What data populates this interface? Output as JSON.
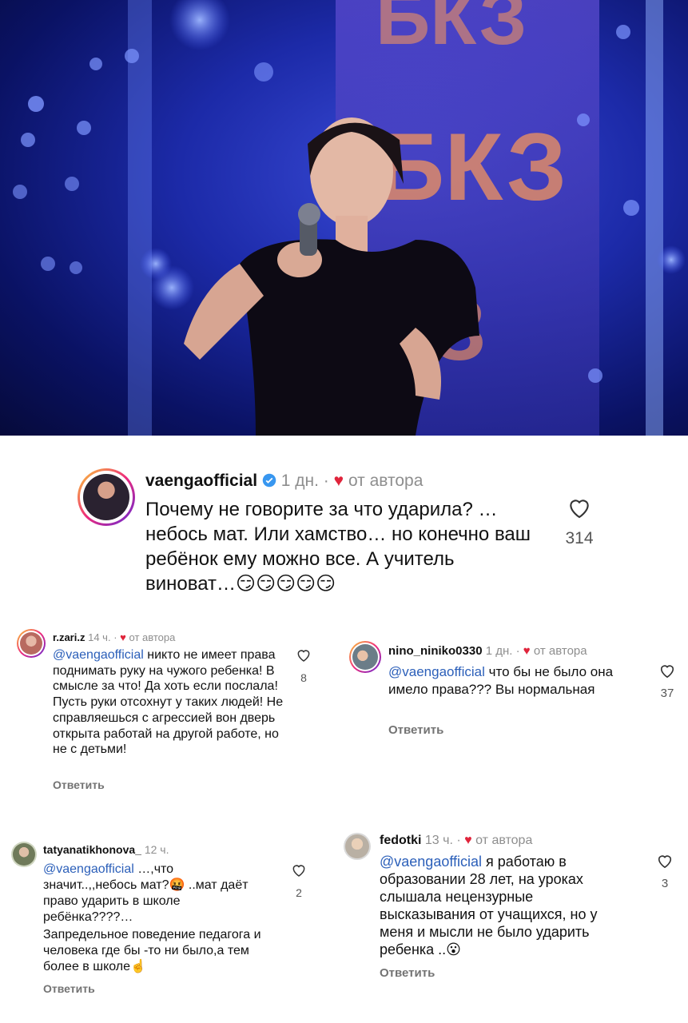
{
  "photo": {
    "description_icon": "concert-photo-singer-with-microphone",
    "stage_logo_text": "БКЗ"
  },
  "main_comment": {
    "username": "vaengaofficial",
    "time": "1 дн.",
    "dot": "·",
    "author_label": "от автора",
    "text": "Почему не говорите за что ударила? … небось мат. Или хамство… но конечно ваш ребёнок ему можно все. А учитель виноват…😏😏😏😏😏",
    "likes": "314"
  },
  "comments": [
    {
      "username": "r.zari.z",
      "time": "14 ч.",
      "dot": "·",
      "author_label": "от автора",
      "mention": "@vaengaofficial",
      "text": " никто не имеет права поднимать руку на чужого ребенка! В смысле за что! Да хоть если послала! Пусть руки отсохнут у таких людей! Не справляешься с агрессией вон дверь открыта работай на другой работе, но не с детьми!",
      "reply": "Ответить",
      "likes": "8"
    },
    {
      "username": "nino_niniko0330",
      "time": "1 дн.",
      "dot": "·",
      "author_label": "от автора",
      "mention": "@vaengaofficial",
      "text": " что бы не было она имело права??? Вы нормальная",
      "reply": "Ответить",
      "likes": "37"
    },
    {
      "username": "tatyanatikhonova_",
      "time": "12 ч.",
      "mention": "@vaengaofficial",
      "text": " …,что значит..,,небось мат?🤬 ..мат даёт право ударить в школе ребёнка????…",
      "text2": "Запредельное поведение педагога и человека где бы -то ни было,а тем более в школе☝️",
      "reply": "Ответить",
      "likes": "2"
    },
    {
      "username": "fedotki",
      "time": "13 ч.",
      "dot": "·",
      "author_label": "от автора",
      "mention": "@vaengaofficial",
      "text": " я работаю в образовании 28 лет, на уроках слышала нецензурные высказывания от учащихся, но у меня и мысли не было ударить ребенка ..😮",
      "reply": "Ответить",
      "likes": "3"
    }
  ],
  "colors": {
    "heart_red": "#e0243b",
    "mention_blue": "#2b5fb9",
    "verified_blue": "#3897f0",
    "muted_gray": "#8e8e8e"
  }
}
